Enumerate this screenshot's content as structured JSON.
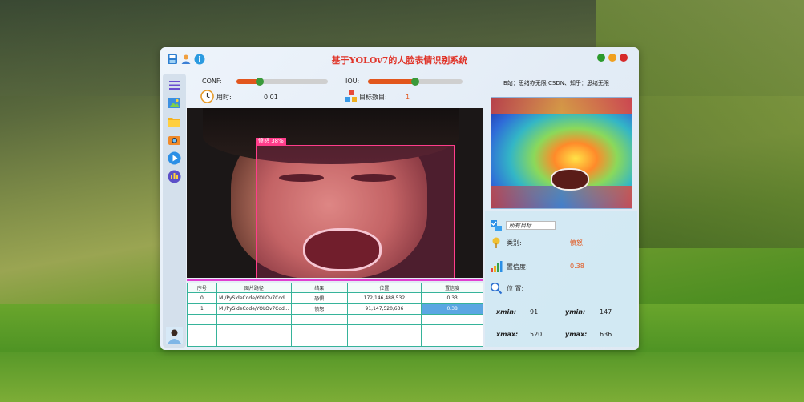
{
  "window": {
    "title": "基于YOLOv7的人脸表情识别系统",
    "credit": "B站：思绪亦无限  CSDN、知乎：思绪无限"
  },
  "controls": {
    "conf_label": "CONF:",
    "conf_value": 0.25,
    "iou_label": "IOU:",
    "iou_value": 0.5,
    "time_label": "用时:",
    "time_value": "0.01",
    "count_label": "目标数目:",
    "count_value": "1"
  },
  "detection": {
    "box_label": "愤怒  38%"
  },
  "table": {
    "headers": [
      "序号",
      "图片路径",
      "结果",
      "位置",
      "置信度"
    ],
    "rows": [
      [
        "0",
        "M:/PySideCode/YOLOv7Cod...",
        "恐惧",
        "172,146,488,532",
        "0.33"
      ],
      [
        "1",
        "M:/PySideCode/YOLOv7Cod...",
        "愤怒",
        "91,147,520,636",
        "0.38"
      ]
    ]
  },
  "info": {
    "target_select": "所有目标",
    "class_label": "类别:",
    "class_value": "愤怒",
    "conf_label": "置信度:",
    "conf_value": "0.38",
    "pos_label": "位 置:",
    "xmin_label": "xmin:",
    "xmin_value": "91",
    "ymin_label": "ymin:",
    "ymin_value": "147",
    "xmax_label": "xmax:",
    "xmax_value": "520",
    "ymax_label": "ymax:",
    "ymax_value": "636"
  },
  "icons": {
    "titlebar": [
      "save-icon",
      "user-icon",
      "info-icon"
    ],
    "sidebar": [
      "menu-icon",
      "image-icon",
      "folder-icon",
      "camera-icon",
      "play-icon",
      "model-icon"
    ],
    "window_buttons": [
      "minimize-icon",
      "maximize-icon",
      "close-icon"
    ]
  },
  "colors": {
    "title": "#e0352a",
    "slider_fill": "#e2561d",
    "slider_knob": "#3a9a3a",
    "bbox": "#ff3d8b",
    "table_border": "#36b39a",
    "table_selected": "#5aa6e2",
    "value_accent": "#e2561d",
    "btn_min": "#2c9a2c",
    "btn_max": "#f0a020",
    "btn_close": "#d62a2a"
  }
}
